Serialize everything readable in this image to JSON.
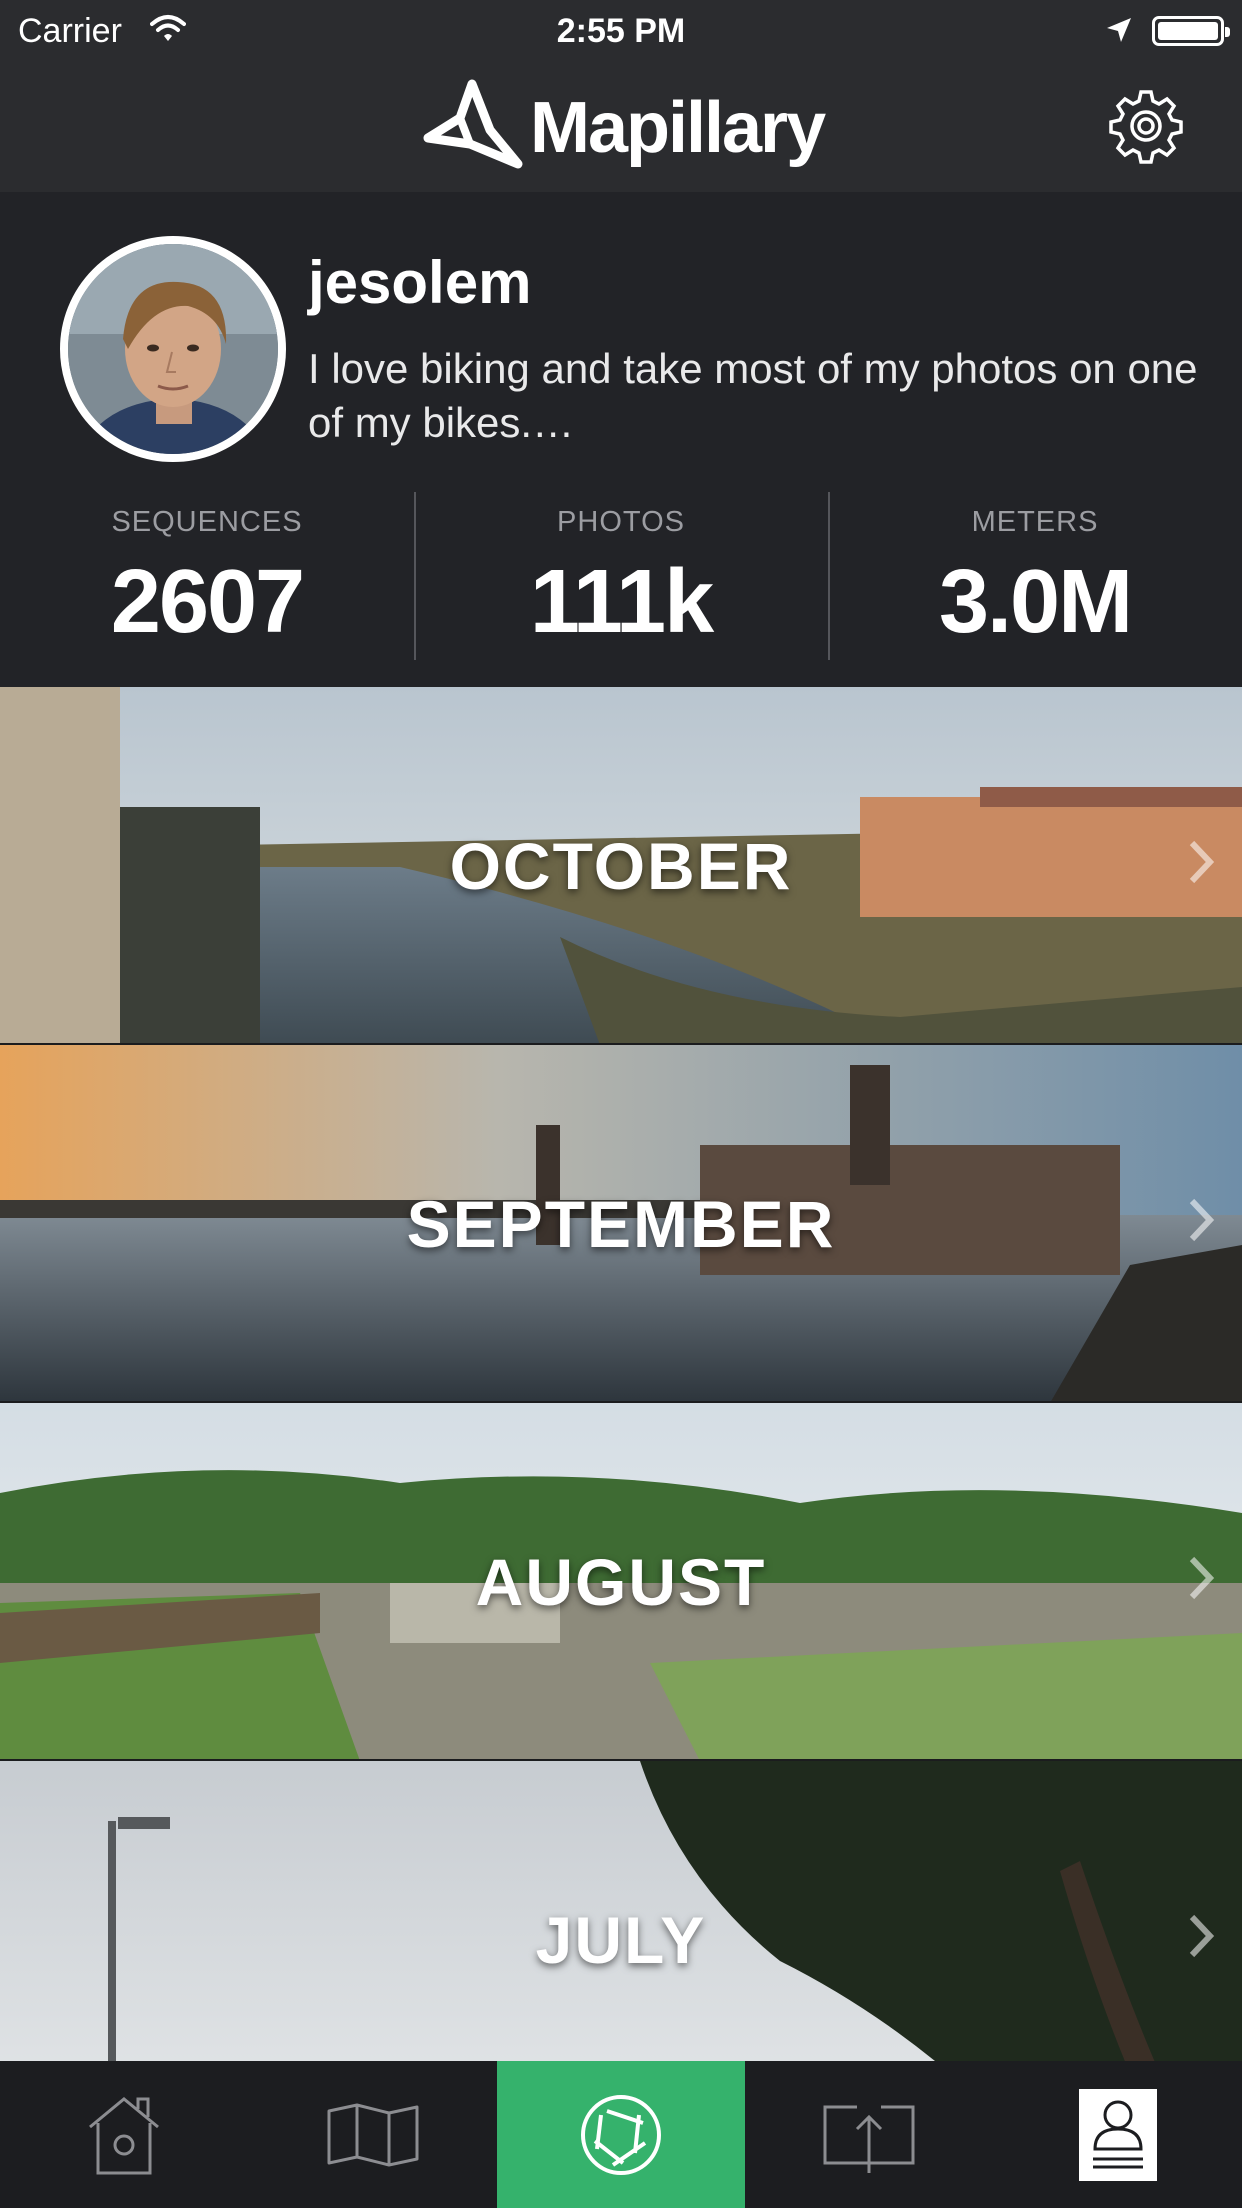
{
  "status_bar": {
    "carrier": "Carrier",
    "time": "2:55 PM"
  },
  "nav": {
    "brand": "Mapillary",
    "settings_icon": "gear-icon"
  },
  "profile": {
    "username": "jesolem",
    "bio": "I love biking and take most of my photos on one of my bikes.…",
    "stats": [
      {
        "label": "SEQUENCES",
        "value": "2607"
      },
      {
        "label": "PHOTOS",
        "value": "111k"
      },
      {
        "label": "METERS",
        "value": "3.0M"
      }
    ]
  },
  "months": [
    {
      "label": "OCTOBER"
    },
    {
      "label": "SEPTEMBER"
    },
    {
      "label": "AUGUST"
    },
    {
      "label": "JULY"
    }
  ],
  "tabs": [
    {
      "icon": "home-icon"
    },
    {
      "icon": "map-icon"
    },
    {
      "icon": "camera-shutter-icon",
      "active": true
    },
    {
      "icon": "upload-icon"
    },
    {
      "icon": "profile-icon"
    }
  ],
  "colors": {
    "accent": "#35b26c",
    "background": "#222327",
    "bar": "#2b2c2f"
  }
}
